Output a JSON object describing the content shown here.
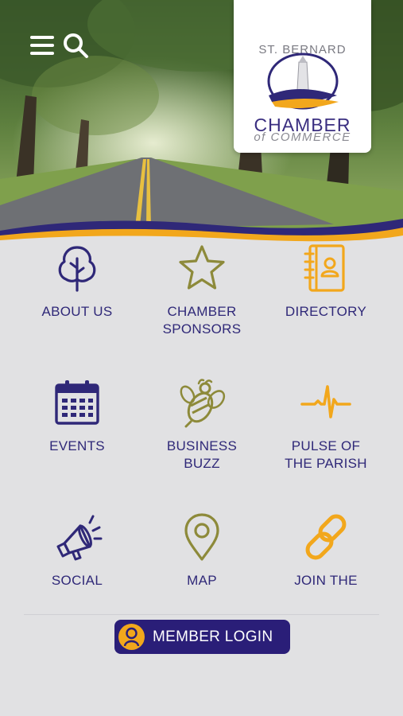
{
  "logo": {
    "line1": "ST. BERNARD",
    "line2": "CHAMBER",
    "line3": "of COMMERCE"
  },
  "header": {
    "menu_icon": "hamburger-menu-icon",
    "search_icon": "search-icon"
  },
  "menu": [
    {
      "label_line1": "ABOUT US",
      "label_line2": "",
      "icon": "tree-icon",
      "color": "#2f2878"
    },
    {
      "label_line1": "CHAMBER",
      "label_line2": "SPONSORS",
      "icon": "star-icon",
      "color": "#8d8a3a"
    },
    {
      "label_line1": "DIRECTORY",
      "label_line2": "",
      "icon": "address-book-icon",
      "color": "#f2a71c"
    },
    {
      "label_line1": "EVENTS",
      "label_line2": "",
      "icon": "calendar-icon",
      "color": "#2f2878"
    },
    {
      "label_line1": "BUSINESS",
      "label_line2": "BUZZ",
      "icon": "bee-icon",
      "color": "#8d8a3a"
    },
    {
      "label_line1": "PULSE OF",
      "label_line2": "THE PARISH",
      "icon": "pulse-icon",
      "color": "#f2a71c"
    },
    {
      "label_line1": "SOCIAL",
      "label_line2": "",
      "icon": "megaphone-icon",
      "color": "#2f2878"
    },
    {
      "label_line1": "MAP",
      "label_line2": "",
      "icon": "map-pin-icon",
      "color": "#8d8a3a"
    },
    {
      "label_line1": "JOIN THE",
      "label_line2": "",
      "icon": "link-icon",
      "color": "#f2a71c"
    }
  ],
  "login": {
    "label": "MEMBER LOGIN",
    "icon": "user-avatar-icon",
    "bg_color": "#2a1e78",
    "accent_color": "#f2a71c"
  }
}
